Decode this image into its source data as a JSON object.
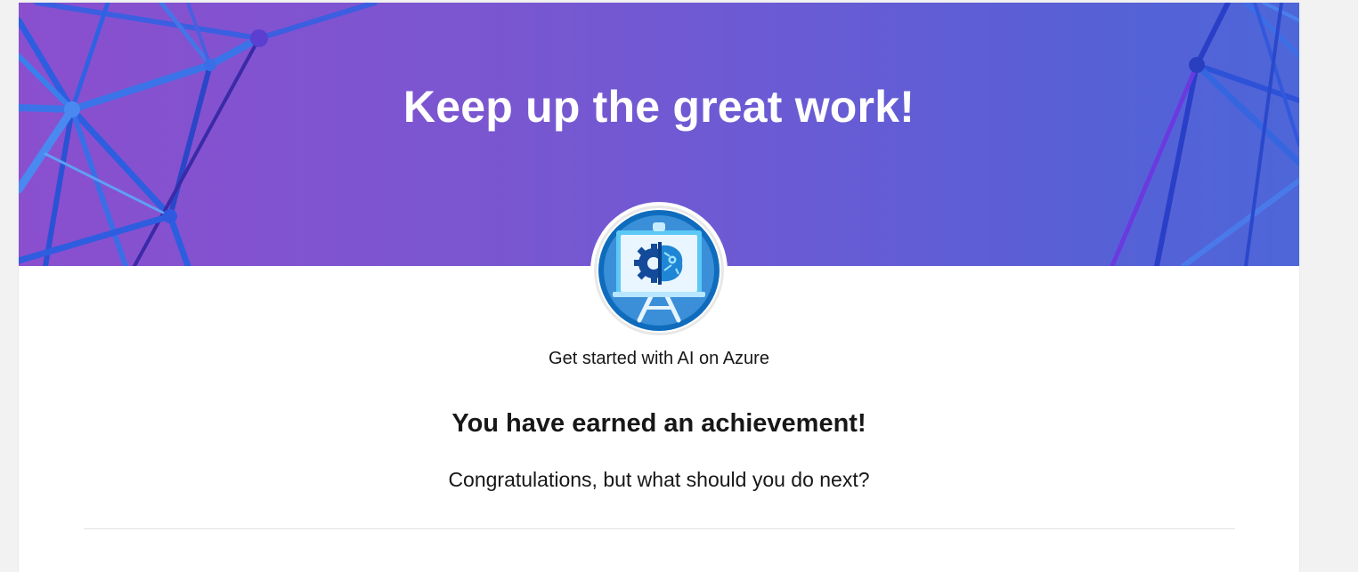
{
  "banner": {
    "headline": "Keep up the great work!"
  },
  "badge": {
    "icon": "ai-presentation-gear-brain-icon",
    "module_title": "Get started with AI on Azure"
  },
  "achievement": {
    "heading": "You have earned an achievement!",
    "prompt": "Congratulations, but what should you do next?"
  },
  "colors": {
    "banner_left": "#8a4fcf",
    "banner_right": "#4d66d8",
    "badge_ring": "#0f6cbd",
    "text": "#171717"
  }
}
